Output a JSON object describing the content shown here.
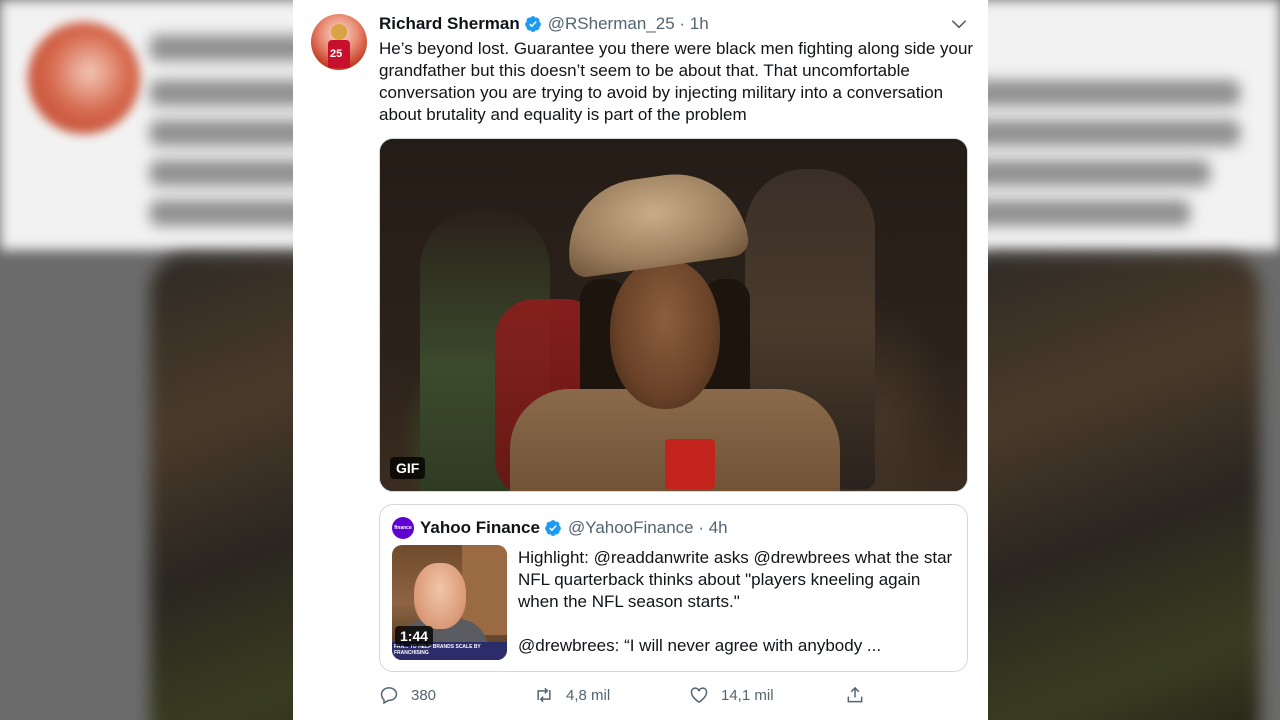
{
  "tweet": {
    "author_name": "Richard Sherman",
    "handle_time": "@RSherman_25 · 1h",
    "avatar_number": "25",
    "text": "He’s beyond lost.  Guarantee you there were black men fighting along side your grandfather but this doesn’t seem to be about that. That uncomfortable conversation you are trying to avoid by injecting military into a conversation about brutality and equality is part of the problem",
    "media_badge": "GIF"
  },
  "quoted": {
    "author_name": "Yahoo Finance",
    "handle_time": "@YahooFinance · 4h",
    "avatar_text": "finance",
    "thumbnail_banner": "FRA... TO HELP BRANDS SCALE BY FRANCHISING",
    "video_duration": "1:44",
    "text_line1": "Highlight: @readdanwrite asks @drewbrees what the star NFL quarterback thinks about \"players kneeling again when the NFL season starts.\"",
    "text_line2": "@drewbrees: “I will never agree with anybody ..."
  },
  "actions": {
    "replies": "380",
    "retweets": "4,8 mil",
    "likes": "14,1 mil"
  },
  "colors": {
    "verified": "#1d9bf0",
    "secondary_text": "#536471",
    "yahoo_purple": "#5f01d1"
  },
  "icons": [
    "verified-badge-icon",
    "chevron-down-icon",
    "reply-icon",
    "retweet-icon",
    "like-icon",
    "share-icon"
  ]
}
